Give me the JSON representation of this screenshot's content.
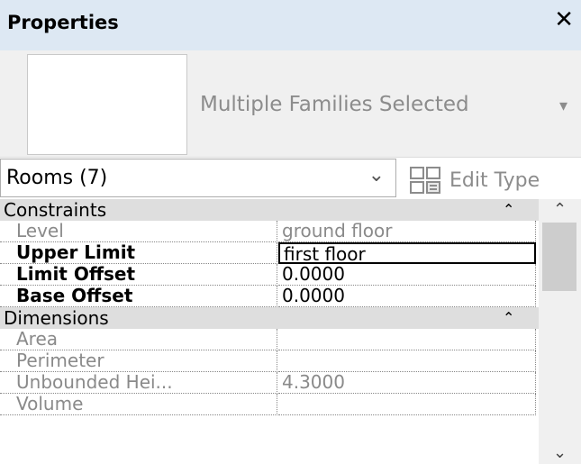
{
  "panel": {
    "title": "Properties",
    "close_icon": "close-icon"
  },
  "type_selector": {
    "type_name": "Multiple Families Selected",
    "dropdown_icon": "dropdown-arrow-icon"
  },
  "filter": {
    "selected": "Rooms (7)",
    "chevron_icon": "chevron-down-icon"
  },
  "edit_type": {
    "label": "Edit Type",
    "icon": "edit-type-icon"
  },
  "groups": [
    {
      "label": "Constraints",
      "collapse_icon": "double-chevron-up-icon",
      "rows": [
        {
          "name": "Level",
          "value": "ground floor"
        },
        {
          "name": "Upper Limit",
          "value": "first floor"
        },
        {
          "name": "Limit Offset",
          "value": "0.0000"
        },
        {
          "name": "Base Offset",
          "value": "0.0000"
        }
      ]
    },
    {
      "label": "Dimensions",
      "collapse_icon": "double-chevron-up-icon",
      "rows": [
        {
          "name": "Area",
          "value": ""
        },
        {
          "name": "Perimeter",
          "value": ""
        },
        {
          "name": "Unbounded Hei...",
          "value": "4.3000"
        },
        {
          "name": "Volume",
          "value": ""
        }
      ]
    }
  ],
  "glyphs": {
    "collapse": "⌃",
    "scroll_up": "⌃",
    "scroll_down": "⌄",
    "chevron": "⌄",
    "dropdown": "▾",
    "close": "✕"
  },
  "colors": {
    "header_bg": "#dde8f3",
    "group_bg": "#dedede",
    "readonly_text": "#8a8a8a"
  }
}
